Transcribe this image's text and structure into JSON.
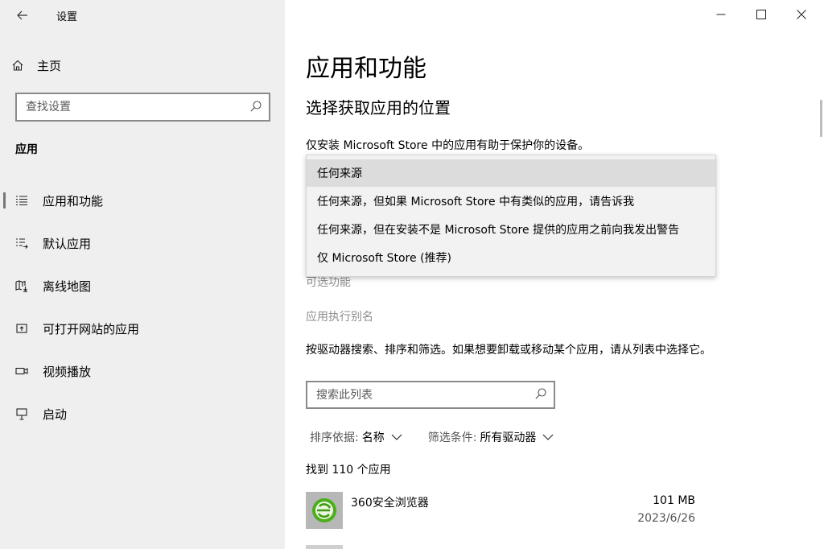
{
  "window": {
    "title": "设置",
    "controls": {
      "minimize": "—",
      "maximize": "☐",
      "close": "✕"
    }
  },
  "sidebar": {
    "home_label": "主页",
    "search_placeholder": "查找设置",
    "section_label": "应用",
    "items": [
      {
        "label": "应用和功能",
        "icon": "apps-features-icon",
        "active": true
      },
      {
        "label": "默认应用",
        "icon": "default-apps-icon",
        "active": false
      },
      {
        "label": "离线地图",
        "icon": "offline-maps-icon",
        "active": false
      },
      {
        "label": "可打开网站的应用",
        "icon": "apps-for-websites-icon",
        "active": false
      },
      {
        "label": "视频播放",
        "icon": "video-playback-icon",
        "active": false
      },
      {
        "label": "启动",
        "icon": "startup-icon",
        "active": false
      }
    ]
  },
  "main": {
    "title": "应用和功能",
    "subtitle": "选择获取应用的位置",
    "description": "仅安装 Microsoft Store 中的应用有助于保护你的设备。",
    "dropdown_options": [
      "任何来源",
      "任何来源，但如果 Microsoft Store 中有类似的应用，请告诉我",
      "任何来源，但在安装不是 Microsoft Store 提供的应用之前向我发出警告",
      "仅 Microsoft Store (推荐)"
    ],
    "dropdown_selected_index": 0,
    "optional_features_link": "可选功能",
    "app_alias_link": "应用执行别名",
    "list_description": "按驱动器搜索、排序和筛选。如果想要卸载或移动某个应用，请从列表中选择它。",
    "list_search_placeholder": "搜索此列表",
    "sort_label": "排序依据:",
    "sort_value": "名称",
    "filter_label": "筛选条件:",
    "filter_value": "所有驱动器",
    "found_count": "找到 110 个应用",
    "apps": [
      {
        "name": "360安全浏览器",
        "size": "101 MB",
        "date": "2023/6/26",
        "icon": "360-browser-icon"
      }
    ]
  },
  "colors": {
    "sidebar_bg": "#efefef",
    "selected_option_bg": "#dcdcdc",
    "dropdown_bg": "#f2f2f2",
    "muted_text": "#8d8d8d",
    "browser_icon_green": "#4caf1a"
  }
}
